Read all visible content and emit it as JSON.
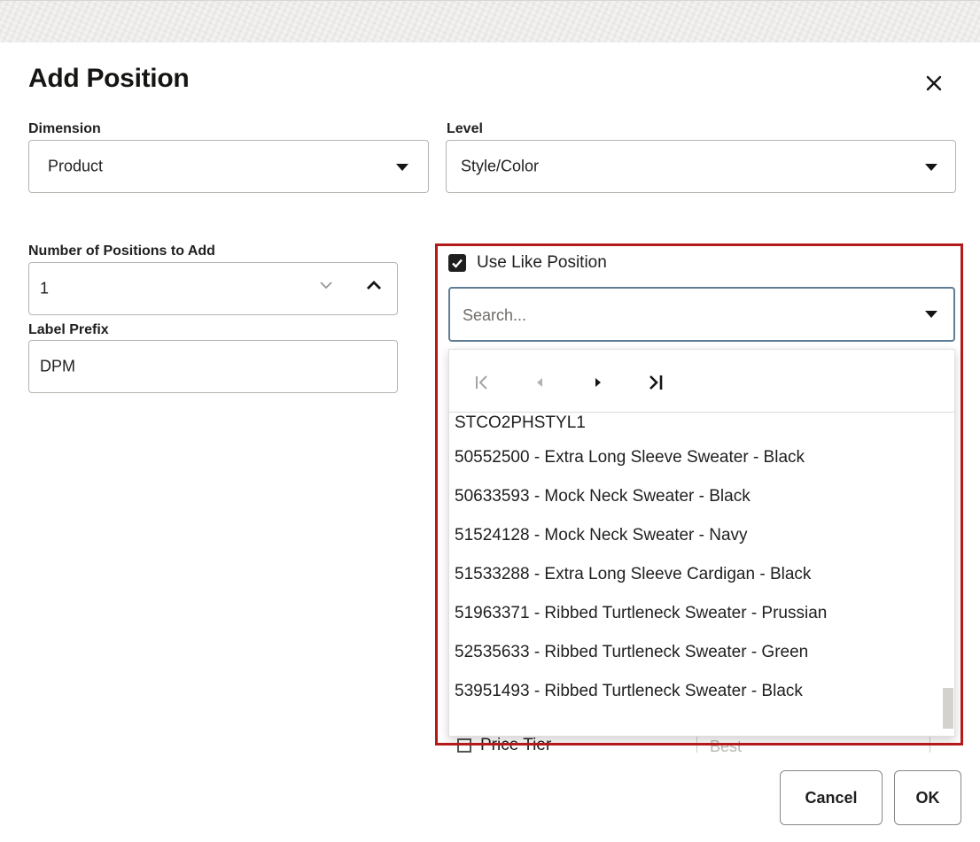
{
  "dialog": {
    "title": "Add Position"
  },
  "dimension": {
    "label": "Dimension",
    "value": "Product"
  },
  "level": {
    "label": "Level",
    "value": "Style/Color"
  },
  "positions_count": {
    "label": "Number of Positions to Add",
    "value": "1"
  },
  "label_prefix": {
    "label": "Label Prefix",
    "value": "DPM"
  },
  "use_like_position": {
    "label": "Use Like Position",
    "checked": true
  },
  "search": {
    "placeholder": "Search..."
  },
  "options": [
    "STCO2PHSTYL1",
    "50552500 - Extra Long Sleeve Sweater - Black",
    "50633593 - Mock Neck Sweater - Black",
    "51524128 - Mock Neck Sweater - Navy",
    "51533288 - Extra Long Sleeve Cardigan - Black",
    "51963371 - Ribbed Turtleneck Sweater - Prussian",
    "52535633 - Ribbed Turtleneck Sweater - Green",
    "53951493 - Ribbed Turtleneck Sweater - Black"
  ],
  "behind": {
    "price_tier_label": "Price Tier",
    "price_tier_value": "Best"
  },
  "buttons": {
    "cancel": "Cancel",
    "ok": "OK"
  },
  "colors": {
    "highlight_border": "#b31b1b",
    "focus_border": "#5f7d95"
  }
}
